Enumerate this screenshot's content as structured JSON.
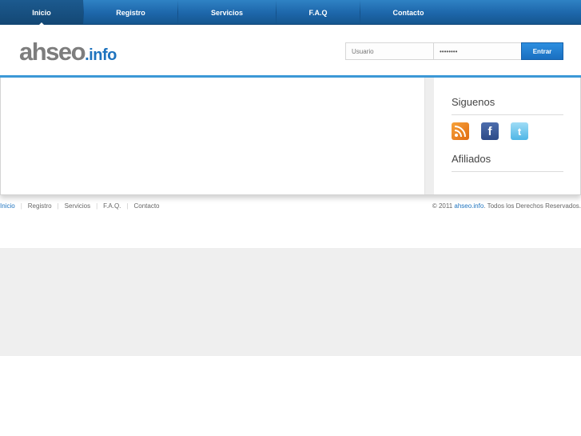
{
  "nav": {
    "items": [
      {
        "label": "Inicio",
        "active": true
      },
      {
        "label": "Registro"
      },
      {
        "label": "Servicios"
      },
      {
        "label": "F.A.Q"
      },
      {
        "label": "Contacto"
      }
    ]
  },
  "logo": {
    "main": "ahseo",
    "ext": ".info"
  },
  "login": {
    "user_placeholder": "Usuario",
    "password_value": "••••••••",
    "submit_label": "Entrar"
  },
  "sidebar": {
    "follow_title": "Siguenos",
    "affiliates_title": "Afiliados",
    "social_icons": [
      "rss-icon",
      "facebook-icon",
      "twitter-icon"
    ]
  },
  "footer": {
    "links": [
      "Inicio",
      "Registro",
      "Servicios",
      "F.A.Q.",
      "Contacto"
    ],
    "copy_prefix": "© 2011 ",
    "copy_brand": "ahseo.info",
    "copy_suffix": ". Todos los Derechos Reservados."
  },
  "colors": {
    "accent": "#1e73be",
    "nav": "#1d66aa"
  }
}
